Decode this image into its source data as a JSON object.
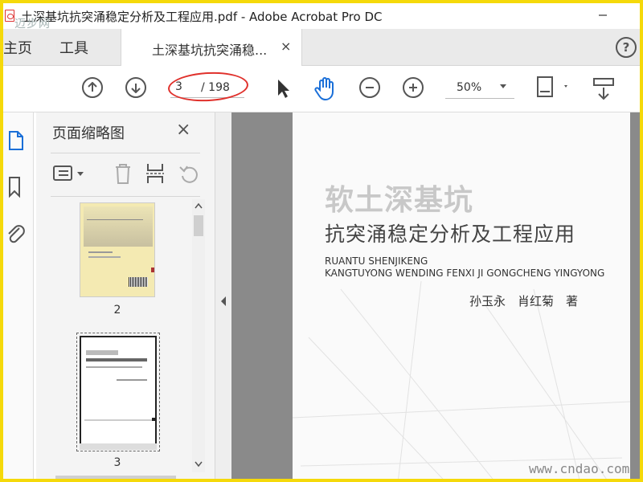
{
  "window": {
    "title": "土深基坑抗突涌稳定分析及工程应用.pdf - Adobe Acrobat Pro DC",
    "watermark_top": "迈步网"
  },
  "tabs": {
    "home": "主页",
    "tools": "工具",
    "document": "土深基坑抗突涌稳...",
    "close": "×",
    "help": "?"
  },
  "toolbar": {
    "page_current": "3",
    "page_total": "/ 198",
    "zoom": "50%"
  },
  "panel": {
    "title": "页面缩略图",
    "close": "×",
    "thumbnails": [
      {
        "label": "2"
      },
      {
        "label": "3"
      }
    ]
  },
  "document": {
    "title_main": "软土深基坑",
    "title_sub": "抗突涌稳定分析及工程应用",
    "pinyin_1": "RUANTU SHENJIKENG",
    "pinyin_2": "KANGTUYONG WENDING FENXI JI GONGCHENG YINGYONG",
    "authors": "孙玉永　肖红菊　著"
  },
  "watermark_bottom": "www.cndao.com",
  "colors": {
    "frame": "#f5d90a",
    "annotation_ring": "#e0312c",
    "hand_tool": "#1a6fd8"
  }
}
